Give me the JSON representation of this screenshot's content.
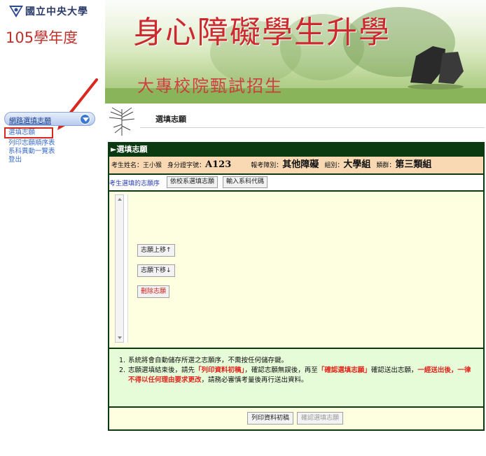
{
  "header": {
    "university_name": "國立中央大學",
    "academic_year": "105學年度",
    "banner_title": "身心障礙學生升學",
    "banner_subtitle": "大專校院甄試招生"
  },
  "sidebar": {
    "header_label": "網路選填志願",
    "items": [
      {
        "label": "選填志願"
      },
      {
        "label": "列印志願順序表"
      },
      {
        "label": "系科異動一覽表"
      },
      {
        "label": "登出"
      }
    ]
  },
  "main": {
    "page_title": "選填志願",
    "panel_title": "►選填志願",
    "student_info": {
      "name_label": "考生姓名：",
      "name": "王小猴",
      "id_label": "身分證字號：",
      "id_number": "A123",
      "category_label": "報考障別：",
      "category": "其他障礙",
      "group_label": "組別：",
      "group": "大學組",
      "class_label": "類群：",
      "class": "第三類組"
    },
    "tabs": {
      "current": "考生選填的志願序",
      "by_school": "依校系選填志願",
      "input_code": "輸入系科代碼"
    },
    "buttons": {
      "move_up": "志願上移↑",
      "move_down": "志願下移↓",
      "delete": "刪除志願",
      "print_draft": "列印資料初稿",
      "confirm": "確認選填志願"
    },
    "notes": [
      {
        "num": "1.",
        "text": "系統將會自動儲存所選之志願序，不需按任何儲存鍵。"
      },
      {
        "num": "2.",
        "part1": "志願選填結束後，請先",
        "highlight1": "「列印資料初稿」",
        "part2": "，確認志願無誤後，再至",
        "highlight2": "「確認選填志願」",
        "part3": "確認送出志願，",
        "highlight3": "一經送出後，一律不得以任何理由要求更改",
        "part4": "，請務必審慎考量後再行送出資料。"
      }
    ]
  },
  "colors": {
    "panel_border": "#0c3a10",
    "student_row_bg": "#f8d9b3",
    "list_bg": "#fefee0",
    "notes_bg": "#e6fbd8",
    "highlight_red": "#e0261e",
    "annotation_red": "#d8281f"
  }
}
